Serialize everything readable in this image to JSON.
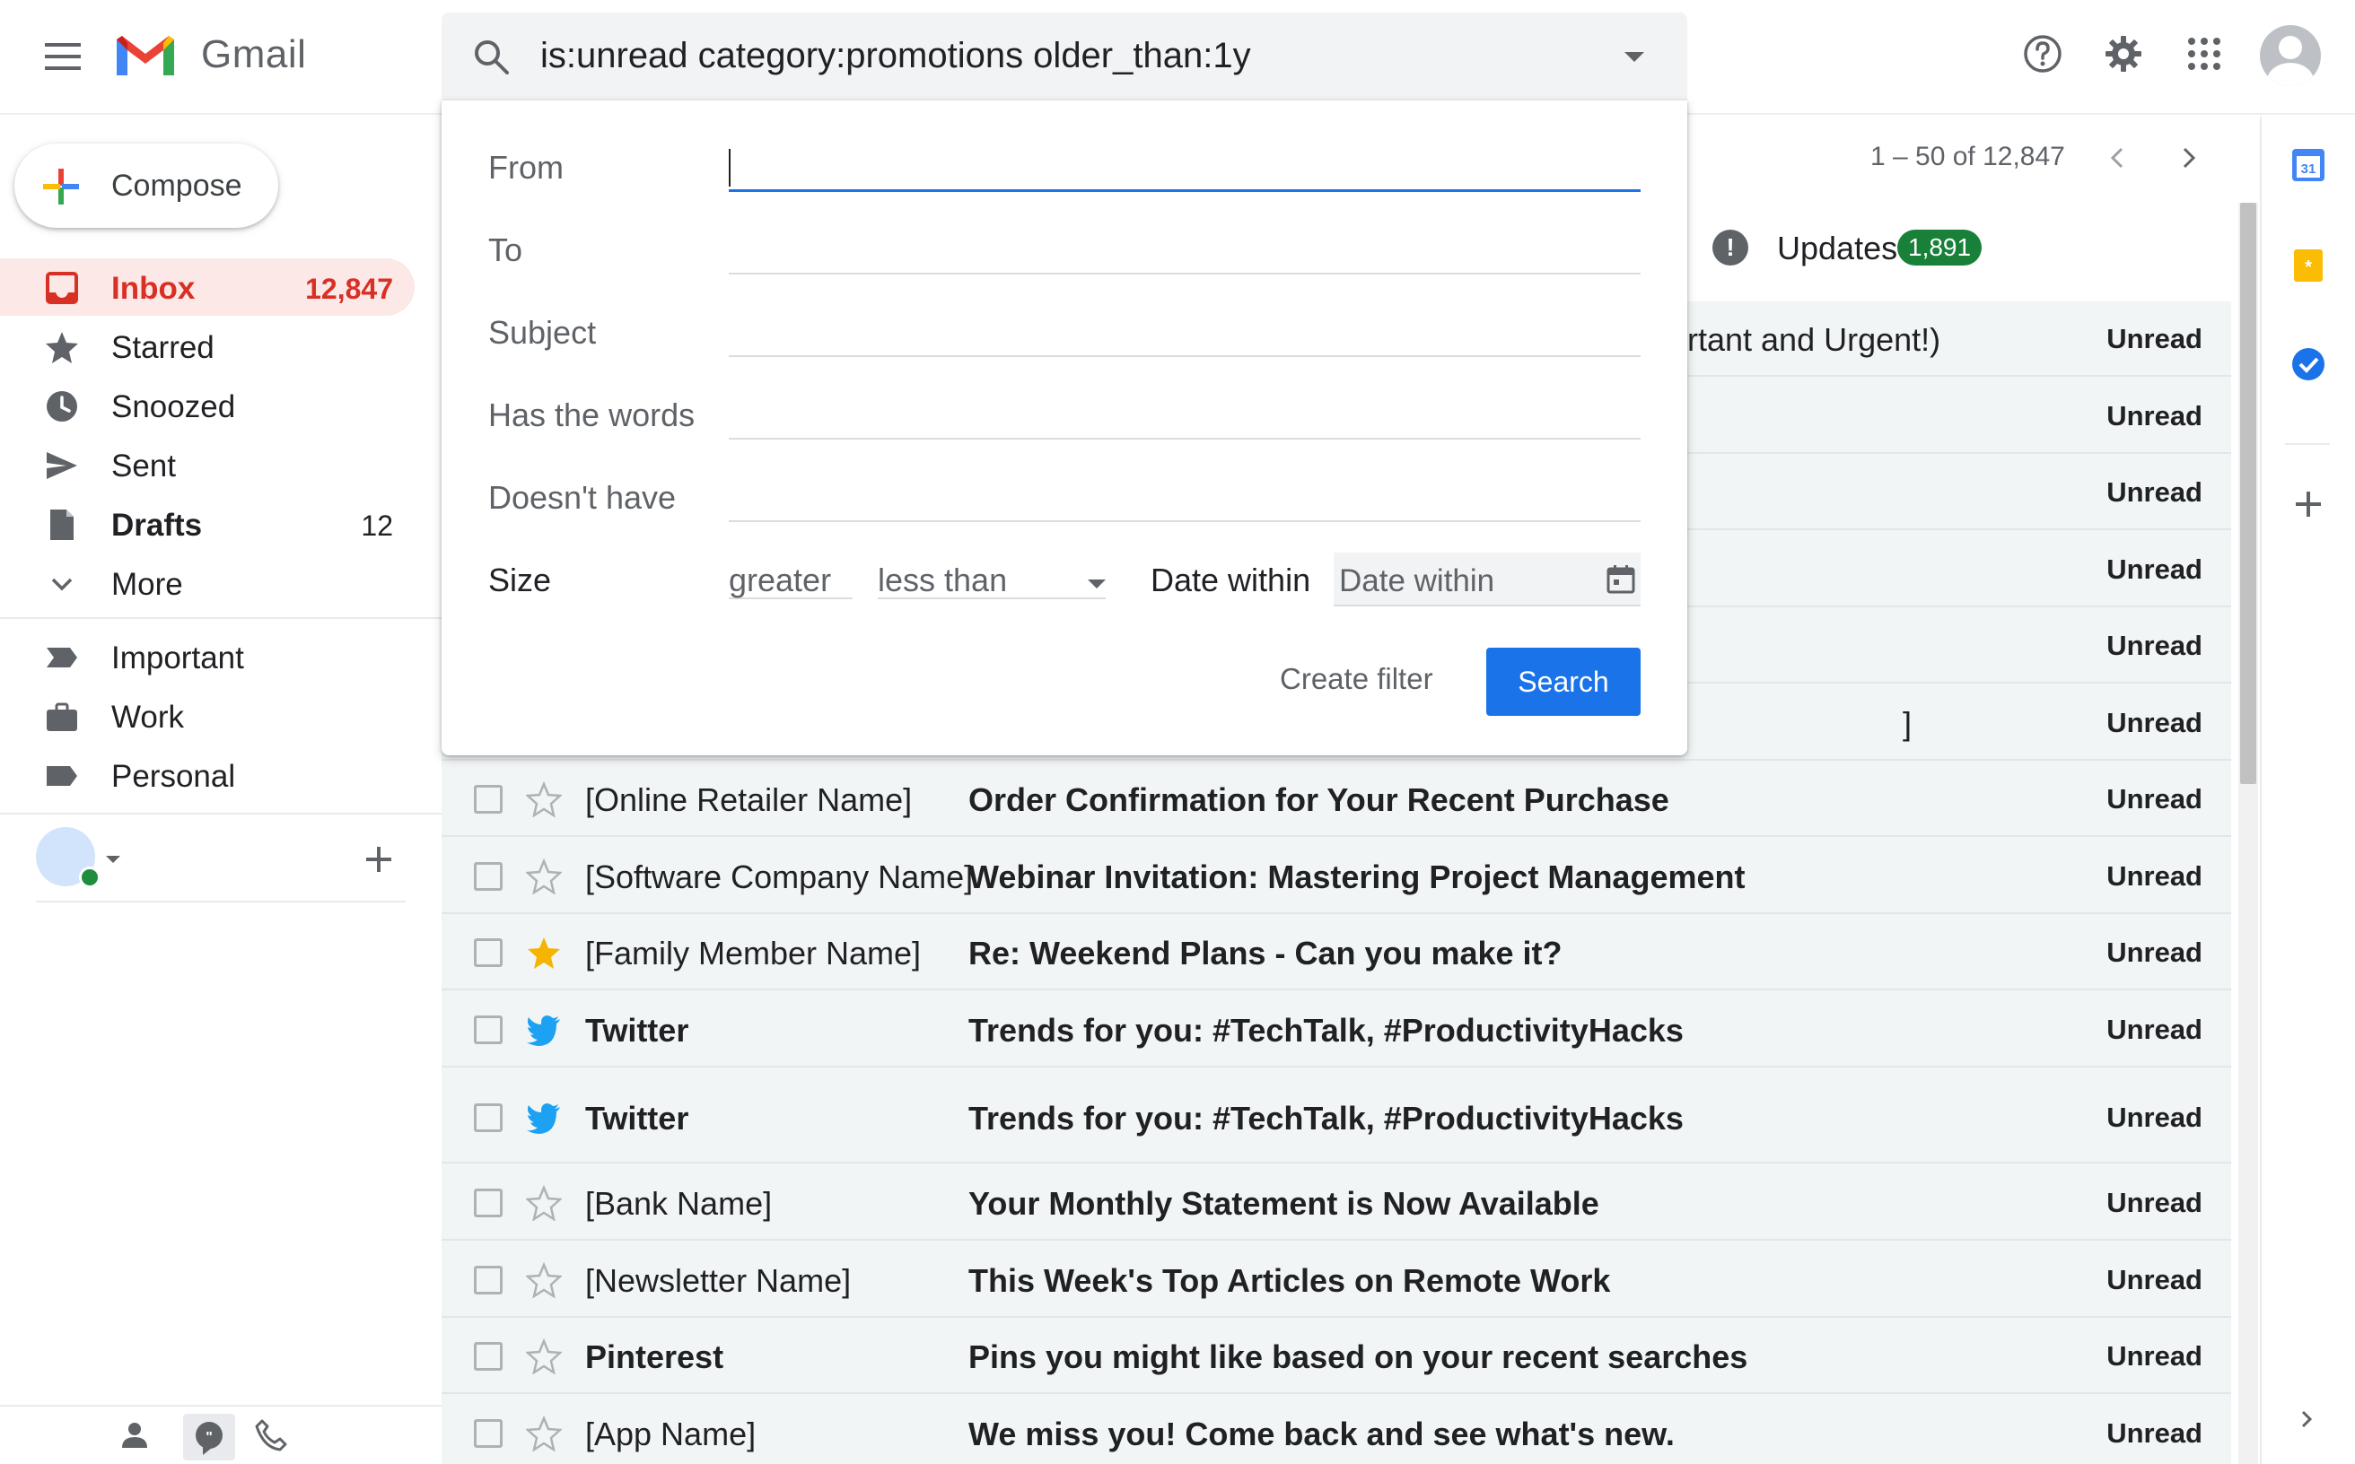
{
  "app": {
    "name": "Gmail"
  },
  "search": {
    "query": "is:unread category:promotions older_than:1y"
  },
  "sidebar": {
    "compose_label": "Compose",
    "items": [
      {
        "label": "Inbox",
        "count": "12,847"
      },
      {
        "label": "Starred",
        "count": ""
      },
      {
        "label": "Snoozed",
        "count": ""
      },
      {
        "label": "Sent",
        "count": ""
      },
      {
        "label": "Drafts",
        "count": "12"
      },
      {
        "label": "More",
        "count": ""
      }
    ],
    "labels": [
      {
        "label": "Important"
      },
      {
        "label": "Work"
      },
      {
        "label": "Personal"
      }
    ]
  },
  "pager": {
    "text": "1 – 50 of 12,847"
  },
  "tabs": {
    "updates": {
      "label": "Updates",
      "badge": "1,891",
      "icon": "info-icon"
    }
  },
  "search_panel": {
    "from_label": "From",
    "to_label": "To",
    "subject_label": "Subject",
    "has_words_label": "Has the words",
    "doesnt_have_label": "Doesn't have",
    "size_label": "Size",
    "size_op_1": "greater",
    "size_op_2": "less than",
    "date_label": "Date within",
    "date_placeholder": "Date within",
    "create_filter": "Create filter",
    "search_button": "Search"
  },
  "emails": [
    {
      "sender": "",
      "subject": "rtant and Urgent!)",
      "status": "Unread",
      "starred": false,
      "icon": "star"
    },
    {
      "sender": "",
      "subject": "",
      "status": "Unread",
      "starred": false,
      "icon": "star"
    },
    {
      "sender": "",
      "subject": "",
      "status": "Unread",
      "starred": false,
      "icon": "star"
    },
    {
      "sender": "",
      "subject": "",
      "status": "Unread",
      "starred": false,
      "icon": "star"
    },
    {
      "sender": "",
      "subject": "",
      "status": "Unread",
      "starred": false,
      "icon": "star"
    },
    {
      "sender": "",
      "subject": "]",
      "status": "Unread",
      "starred": false,
      "icon": "star"
    },
    {
      "sender": "[Online Retailer Name]",
      "subject": "Order Confirmation for Your Recent Purchase",
      "status": "Unread",
      "starred": false,
      "icon": "star"
    },
    {
      "sender": "[Software Company Name]",
      "subject": "Webinar Invitation: Mastering Project Management",
      "status": "Unread",
      "starred": false,
      "icon": "star"
    },
    {
      "sender": "[Family Member Name]",
      "subject": "Re: Weekend Plans - Can you make it?",
      "status": "Unread",
      "starred": true,
      "icon": "star"
    },
    {
      "sender": "Twitter",
      "subject": "Trends for you: #TechTalk, #ProductivityHacks",
      "status": "Unread",
      "starred": false,
      "icon": "twitter"
    },
    {
      "sender": "Twitter",
      "subject": "Trends for you: #TechTalk, #ProductivityHacks",
      "status": "Unread",
      "starred": false,
      "icon": "twitter"
    },
    {
      "sender": "[Bank Name]",
      "subject": "Your Monthly Statement is Now Available",
      "status": "Unread",
      "starred": false,
      "icon": "star"
    },
    {
      "sender": "[Newsletter Name]",
      "subject": "This Week's Top Articles on Remote Work",
      "status": "Unread",
      "starred": false,
      "icon": "star"
    },
    {
      "sender": "Pinterest",
      "subject": "Pins you might like based on your recent searches",
      "status": "Unread",
      "starred": false,
      "icon": "star"
    },
    {
      "sender": "[App Name]",
      "subject": "We miss you! Come back and see what's new.",
      "status": "Unread",
      "starred": false,
      "icon": "star"
    }
  ],
  "side_panel": {
    "calendar_day": "31"
  },
  "colors": {
    "accent_red": "#d93025",
    "accent_blue": "#1a73e8",
    "badge_green": "#188038",
    "star_yellow": "#f4b400",
    "twitter_blue": "#1da1f2"
  }
}
